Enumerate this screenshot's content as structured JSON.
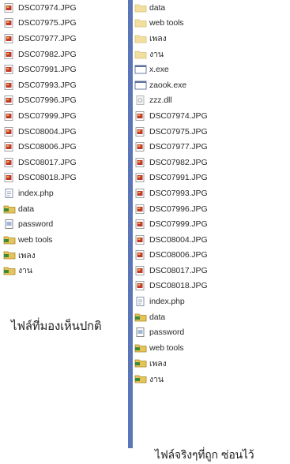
{
  "left": {
    "files": [
      {
        "name": "DSC07974.JPG",
        "icon": "jpg-file-icon"
      },
      {
        "name": "DSC07975.JPG",
        "icon": "jpg-file-icon"
      },
      {
        "name": "DSC07977.JPG",
        "icon": "jpg-file-icon"
      },
      {
        "name": "DSC07982.JPG",
        "icon": "jpg-file-icon"
      },
      {
        "name": "DSC07991.JPG",
        "icon": "jpg-file-icon"
      },
      {
        "name": "DSC07993.JPG",
        "icon": "jpg-file-icon"
      },
      {
        "name": "DSC07996.JPG",
        "icon": "jpg-file-icon"
      },
      {
        "name": "DSC07999.JPG",
        "icon": "jpg-file-icon"
      },
      {
        "name": "DSC08004.JPG",
        "icon": "jpg-file-icon"
      },
      {
        "name": "DSC08006.JPG",
        "icon": "jpg-file-icon"
      },
      {
        "name": "DSC08017.JPG",
        "icon": "jpg-file-icon"
      },
      {
        "name": "DSC08018.JPG",
        "icon": "jpg-file-icon"
      },
      {
        "name": "index.php",
        "icon": "php-file-icon"
      },
      {
        "name": "data",
        "icon": "folder-icon"
      },
      {
        "name": "password",
        "icon": "text-file-icon"
      },
      {
        "name": "web tools",
        "icon": "folder-icon"
      },
      {
        "name": "เพลง",
        "icon": "folder-icon"
      },
      {
        "name": "งาน",
        "icon": "folder-icon"
      }
    ],
    "caption": "ไฟล์ที่มองเห็นปกติ"
  },
  "right": {
    "files": [
      {
        "name": "data",
        "icon": "hidden-folder-icon"
      },
      {
        "name": "web tools",
        "icon": "hidden-folder-icon"
      },
      {
        "name": "เพลง",
        "icon": "hidden-folder-icon"
      },
      {
        "name": "งาน",
        "icon": "hidden-folder-icon"
      },
      {
        "name": "x.exe",
        "icon": "exe-file-icon"
      },
      {
        "name": "zaook.exe",
        "icon": "exe-file-icon"
      },
      {
        "name": "zzz.dll",
        "icon": "dll-file-icon"
      },
      {
        "name": "DSC07974.JPG",
        "icon": "jpg-file-icon"
      },
      {
        "name": "DSC07975.JPG",
        "icon": "jpg-file-icon"
      },
      {
        "name": "DSC07977.JPG",
        "icon": "jpg-file-icon"
      },
      {
        "name": "DSC07982.JPG",
        "icon": "jpg-file-icon"
      },
      {
        "name": "DSC07991.JPG",
        "icon": "jpg-file-icon"
      },
      {
        "name": "DSC07993.JPG",
        "icon": "jpg-file-icon"
      },
      {
        "name": "DSC07996.JPG",
        "icon": "jpg-file-icon"
      },
      {
        "name": "DSC07999.JPG",
        "icon": "jpg-file-icon"
      },
      {
        "name": "DSC08004.JPG",
        "icon": "jpg-file-icon"
      },
      {
        "name": "DSC08006.JPG",
        "icon": "jpg-file-icon"
      },
      {
        "name": "DSC08017.JPG",
        "icon": "jpg-file-icon"
      },
      {
        "name": "DSC08018.JPG",
        "icon": "jpg-file-icon"
      },
      {
        "name": "index.php",
        "icon": "php-file-icon"
      },
      {
        "name": "data",
        "icon": "folder-icon"
      },
      {
        "name": "password",
        "icon": "text-file-icon"
      },
      {
        "name": "web tools",
        "icon": "folder-icon"
      },
      {
        "name": "เพลง",
        "icon": "folder-icon"
      },
      {
        "name": "งาน",
        "icon": "folder-icon"
      }
    ],
    "caption": "ไฟล์จริงๆที่ถูก ซ่อนไว้"
  },
  "colors": {
    "divider": "#5a75b8",
    "folder": "#e6c45a",
    "hidden_folder": "#f2dfa0",
    "jpg_red": "#c0392b"
  }
}
